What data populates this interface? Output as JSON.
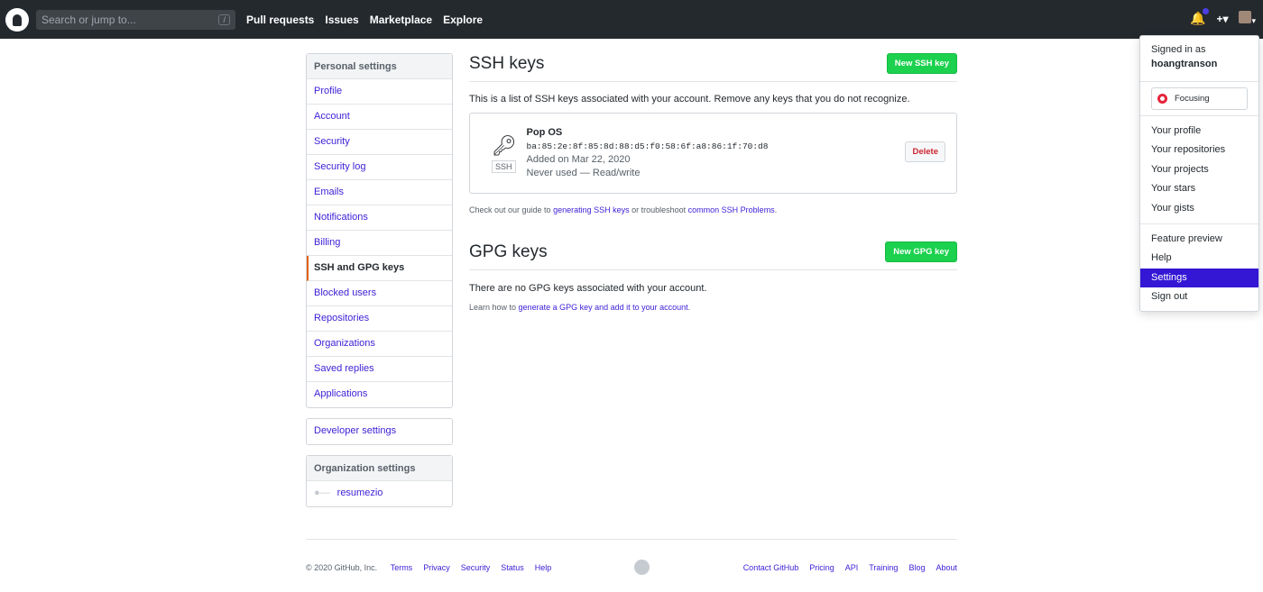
{
  "header": {
    "search_placeholder": "Search or jump to...",
    "slash": "/",
    "nav": [
      "Pull requests",
      "Issues",
      "Marketplace",
      "Explore"
    ],
    "plus": "+▾",
    "avatar_caret": "▾"
  },
  "sidebar": {
    "personal_title": "Personal settings",
    "items": [
      "Profile",
      "Account",
      "Security",
      "Security log",
      "Emails",
      "Notifications",
      "Billing",
      "SSH and GPG keys",
      "Blocked users",
      "Repositories",
      "Organizations",
      "Saved replies",
      "Applications"
    ],
    "selected": "SSH and GPG keys",
    "developer": "Developer settings",
    "org_title": "Organization settings",
    "org": "resumezio"
  },
  "ssh": {
    "title": "SSH keys",
    "new_button": "New SSH key",
    "description": "This is a list of SSH keys associated with your account. Remove any keys that you do not recognize.",
    "key": {
      "badge": "SSH",
      "name": "Pop OS",
      "fingerprint": "ba:85:2e:8f:85:8d:88:d5:f0:58:6f:a8:86:1f:70:d8",
      "added": "Added on Mar 22, 2020",
      "usage": "Never used — Read/write",
      "delete": "Delete"
    },
    "guide_pre": "Check out our guide to ",
    "guide_link": "generating SSH keys",
    "guide_mid": " or troubleshoot ",
    "guide_link2": "common SSH Problems",
    "guide_end": "."
  },
  "gpg": {
    "title": "GPG keys",
    "new_button": "New GPG key",
    "empty": "There are no GPG keys associated with your account.",
    "learn_pre": "Learn how to ",
    "learn_link": "generate a GPG key and add it to your account",
    "learn_end": "."
  },
  "menu": {
    "signed_in": "Signed in as",
    "username": "hoangtranson",
    "status": "Focusing",
    "items1": [
      "Your profile",
      "Your repositories",
      "Your projects",
      "Your stars",
      "Your gists"
    ],
    "items2": [
      "Feature preview",
      "Help",
      "Settings",
      "Sign out"
    ],
    "active": "Settings"
  },
  "footer": {
    "copyright": "© 2020 GitHub, Inc.",
    "left": [
      "Terms",
      "Privacy",
      "Security",
      "Status",
      "Help"
    ],
    "right": [
      "Contact GitHub",
      "Pricing",
      "API",
      "Training",
      "Blog",
      "About"
    ]
  }
}
